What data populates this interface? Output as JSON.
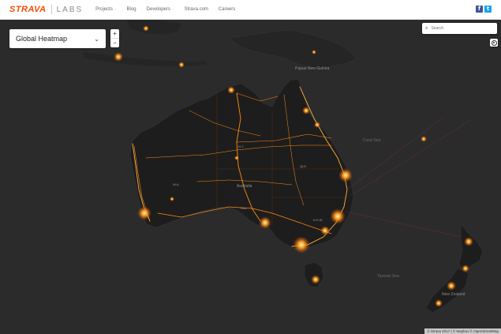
{
  "brand": {
    "name": "STRAVA",
    "suffix": "LABS",
    "accent": "#fc4c02"
  },
  "nav": [
    {
      "label": "Projects"
    },
    {
      "label": "Blog"
    },
    {
      "label": "Developers"
    },
    {
      "label": "Strava.com"
    },
    {
      "label": "Careers"
    }
  ],
  "social": {
    "facebook": "f",
    "twitter": "t"
  },
  "map": {
    "layer_select": {
      "label": "Global Heatmap",
      "chevron": "⌄"
    },
    "zoom": {
      "in": "+",
      "out": "−"
    },
    "search": {
      "placeholder": "Search",
      "icon": "search-icon"
    },
    "locate_icon": "crosshair-icon",
    "colors": {
      "water": "#2b2b2b",
      "land": "#1d1d1d",
      "heat": "#ff9a1a",
      "heat_hot": "#fff1b8"
    },
    "labels": {
      "papua_new_guinea": "Papua New Guinea",
      "coral_sea": "Coral Sea",
      "tasman_sea": "Tasman Sea",
      "australia": "Australia",
      "new_zealand": "New Zealand",
      "nt": "N.T.",
      "wa": "W.A.",
      "qld": "QLD",
      "sa": "S.A.",
      "nsw": "N.S.W."
    },
    "attribution": "© Strava 2017 | © Mapbox © OpenStreetMap"
  }
}
